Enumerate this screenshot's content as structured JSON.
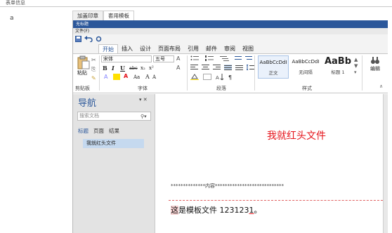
{
  "header": {
    "text": "表单信息"
  },
  "left_label": "a",
  "tabs": [
    {
      "label": "加盖印章"
    },
    {
      "label": "套用模板"
    }
  ],
  "window": {
    "title": "无标题",
    "menu": "文件(F)"
  },
  "ribbon_tabs": [
    {
      "label": "开始"
    },
    {
      "label": "插入"
    },
    {
      "label": "设计"
    },
    {
      "label": "页面布局"
    },
    {
      "label": "引用"
    },
    {
      "label": "邮件"
    },
    {
      "label": "审阅"
    },
    {
      "label": "视图"
    }
  ],
  "ribbon": {
    "clipboard": {
      "paste_label": "粘贴",
      "group_label": "剪贴板"
    },
    "font": {
      "font_name": "宋体",
      "font_size": "五号",
      "bold": "B",
      "italic": "I",
      "underline": "U",
      "strikethrough": "abc",
      "subscript": "x₂",
      "superscript": "x²",
      "change_case": "Aa",
      "grow": "A",
      "shrink": "A",
      "group_label": "字体"
    },
    "paragraph": {
      "group_label": "段落"
    },
    "styles": {
      "items": [
        {
          "sample": "AaBbCcDdI",
          "name": "正文"
        },
        {
          "sample": "AaBbCcDdI",
          "name": "无间隔"
        },
        {
          "sample": "AaBb",
          "name": "标题 1"
        }
      ],
      "group_label": "样式"
    },
    "editing": {
      "label": "编辑"
    }
  },
  "nav_pane": {
    "title": "导航",
    "search_placeholder": "搜索文档",
    "tabs": [
      {
        "label": "标题"
      },
      {
        "label": "页面"
      },
      {
        "label": "结果"
      }
    ],
    "items": [
      {
        "label": "我就红头文件"
      }
    ]
  },
  "document": {
    "title": "我就红头文件",
    "separator": "**************内容****************************",
    "body_prefix": "这",
    "body_main": "是模板文件 123123",
    "body_underlined": "1",
    "body_suffix": "。"
  },
  "colors": {
    "accent": "#2b579a",
    "red": "#e5131a",
    "nav_bg": "#e3e3e3"
  }
}
